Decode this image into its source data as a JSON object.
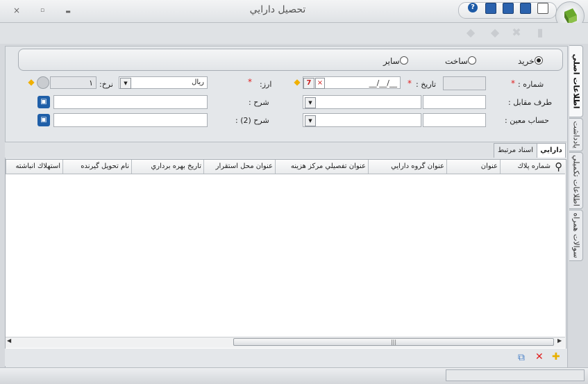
{
  "window": {
    "title": "تحصيل دارايي",
    "close": "×",
    "maximize": "▫",
    "minimize": "▬"
  },
  "quick_access": {
    "icons": [
      "help-icon",
      "save-as-icon",
      "save-close-icon",
      "save-icon",
      "new-document-icon"
    ],
    "help_glyph": "?"
  },
  "toolbar": {
    "icons": [
      "next-record-icon",
      "previous-record-icon",
      "delete-icon",
      "duplicate-icon"
    ]
  },
  "type_options": [
    {
      "label": "خريد",
      "selected": true
    },
    {
      "label": "ساخت",
      "selected": false
    },
    {
      "label": "ساير",
      "selected": false
    }
  ],
  "form": {
    "number_label": "شماره :",
    "date_label": "تاريخ :",
    "date_value": "__/__/__",
    "currency_label": "ارز:",
    "currency_value": "ريال",
    "rate_label": "نرخ:",
    "rate_value": "١",
    "counterparty_label": "طرف مقابل :",
    "description_label": "شرح :",
    "account_label": "حساب معين :",
    "description2_label": "شرح (2) :",
    "required_mark": "*",
    "date_glyph": "7",
    "clear_glyph": "×",
    "dropdown_glyph": "▼",
    "save_glyph": "▣",
    "warn_glyph": "◆"
  },
  "side_tabs": [
    "اطلاعات اصلي",
    "يادداشت",
    "اطلاعات تكميلي",
    "سوالات همراه"
  ],
  "grid_tabs": [
    "دارايي",
    "اسناد مرتبط"
  ],
  "grid": {
    "columns": [
      "شماره پلاك",
      "عنوان",
      "عنوان گروه دارايي",
      "عنوان تفصيلي مركز هزينه",
      "عنوان محل استقرار",
      "تاريخ بهره برداري",
      "نام تحويل گيرنده",
      "استهلاك انباشته"
    ],
    "rows": [],
    "search_glyph": "⚲",
    "scroll_left": "◀",
    "scroll_right": "▶",
    "thumb_grip": "|||"
  },
  "footer": {
    "copy_glyph": "⧉",
    "delete_glyph": "✕",
    "add_glyph": "✚"
  },
  "colors": {
    "delete": "#e02020",
    "add": "#e8b000",
    "save": "#1f5fa8"
  }
}
